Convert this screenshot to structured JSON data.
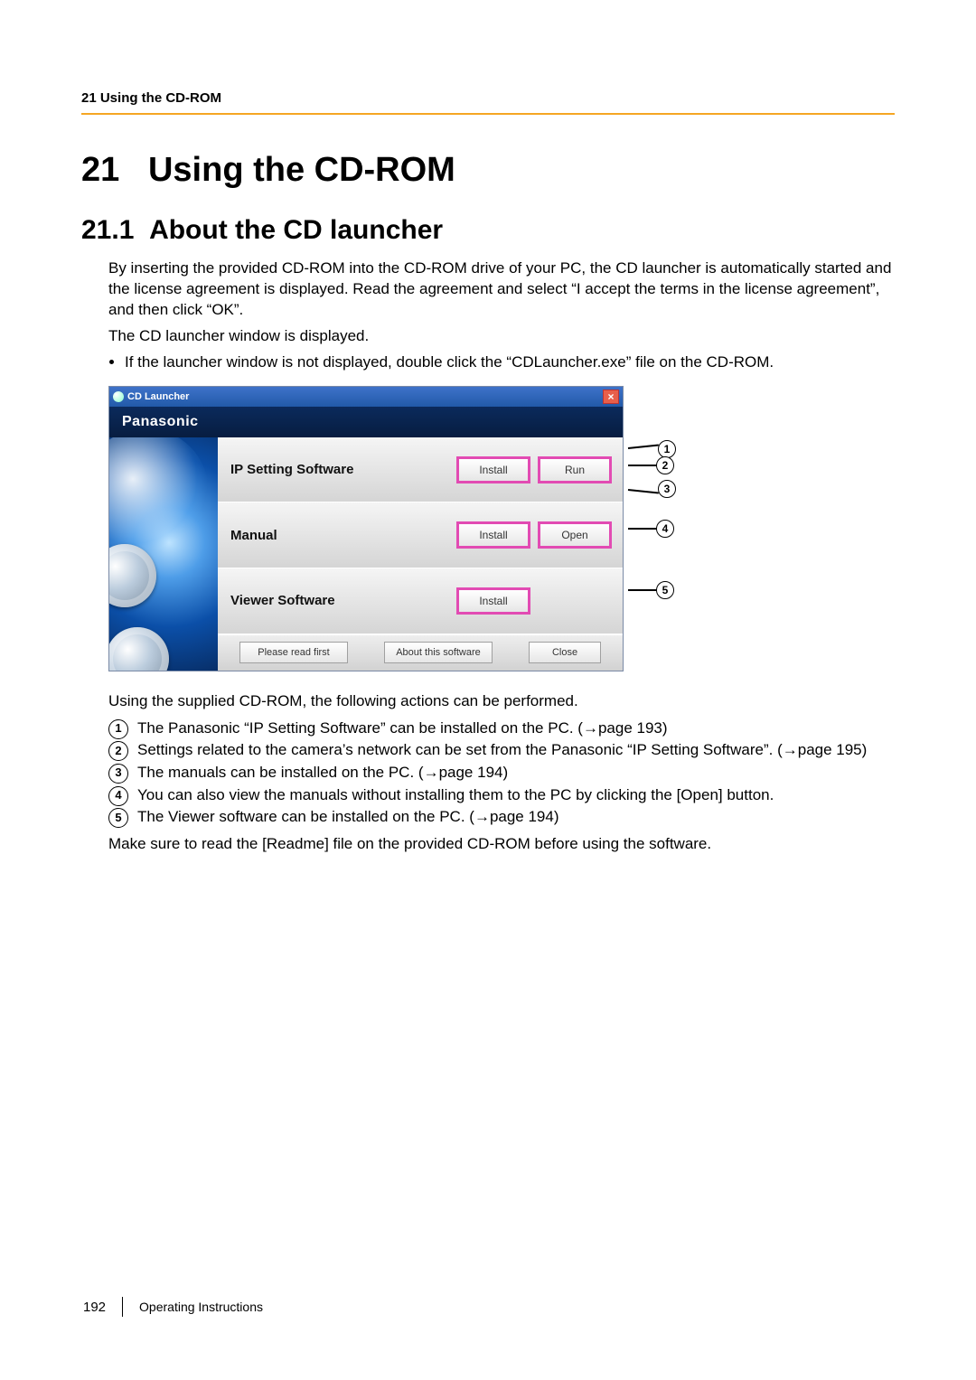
{
  "header": {
    "running": "21 Using the CD-ROM"
  },
  "chapter": {
    "num": "21",
    "title": "Using the CD-ROM"
  },
  "section": {
    "num": "21.1",
    "title": "About the CD launcher"
  },
  "intro": {
    "p1": "By inserting the provided CD-ROM into the CD-ROM drive of your PC, the CD launcher is automatically started and the license agreement is displayed. Read the agreement and select “I accept the terms in the license agreement”, and then click “OK”.",
    "p2": "The CD launcher window is displayed.",
    "bullet1": "If the launcher window is not displayed, double click the “CDLauncher.exe” file on the CD-ROM."
  },
  "launcher": {
    "title": "CD Launcher",
    "brand": "Panasonic",
    "rows": [
      {
        "label": "IP Setting Software",
        "b1": "Install",
        "b2": "Run"
      },
      {
        "label": "Manual",
        "b1": "Install",
        "b2": "Open"
      },
      {
        "label": "Viewer Software",
        "b1": "Install",
        "b2": ""
      }
    ],
    "bottom": {
      "read": "Please read first",
      "about": "About this software",
      "close": "Close"
    },
    "callouts": [
      "1",
      "2",
      "3",
      "4",
      "5"
    ]
  },
  "legend": {
    "lead": "Using the supplied CD-ROM, the following actions can be performed.",
    "items": [
      "The Panasonic “IP Setting Software” can be installed on the PC. (→page 193)",
      "Settings related to the camera’s network can be set from the Panasonic “IP Setting Software”. (→page 195)",
      "The manuals can be installed on the PC. (→page 194)",
      "You can also view the manuals without installing them to the PC by clicking the [Open] button.",
      "The Viewer software can be installed on the PC. (→page 194)"
    ],
    "tail": "Make sure to read the [Readme] file on the provided CD-ROM before using the software."
  },
  "footer": {
    "page": "192",
    "doc": "Operating Instructions"
  }
}
